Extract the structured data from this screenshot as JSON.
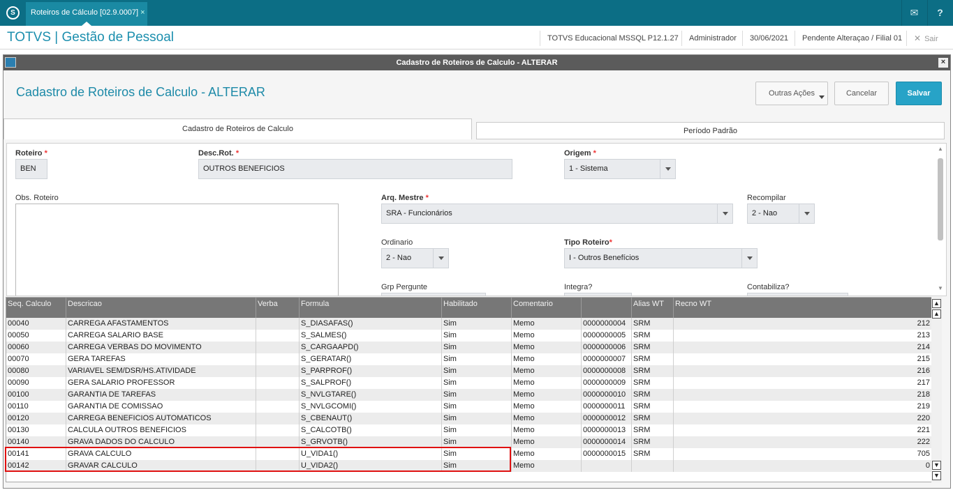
{
  "topbar": {
    "tab_title": "Roteiros de Cálculo [02.9.0007]",
    "tab_close": "×",
    "logo": "S",
    "mail_icon": "✉",
    "help_icon": "?"
  },
  "header": {
    "brand": "TOTVS | Gestão de Pessoal",
    "env": "TOTVS Educacional MSSQL P12.1.27",
    "user": "Administrador",
    "date": "30/06/2021",
    "status": "Pendente Alteraçao / Filial 01",
    "logout": "Sair",
    "logout_icon": "✕"
  },
  "window": {
    "title": "Cadastro de Roteiros de Calculo - ALTERAR",
    "close": "×"
  },
  "page": {
    "title": "Cadastro de Roteiros de Calculo - ALTERAR"
  },
  "actions": {
    "more": "Outras Ações",
    "cancel": "Cancelar",
    "save": "Salvar"
  },
  "tabs": [
    {
      "label": "Cadastro de Roteiros de Calculo"
    },
    {
      "label": "Período Padrão"
    }
  ],
  "form": {
    "roteiro": {
      "label": "Roteiro",
      "value": "BEN"
    },
    "desc": {
      "label": "Desc.Rot.",
      "value": "OUTROS BENEFICIOS"
    },
    "origem": {
      "label": "Origem",
      "value": "1 - Sistema"
    },
    "obs": {
      "label": "Obs. Roteiro",
      "value": ""
    },
    "arq_mestre": {
      "label": "Arq. Mestre",
      "value": "SRA - Funcionários"
    },
    "recompilar": {
      "label": "Recompilar",
      "value": "2 - Nao"
    },
    "ordinario": {
      "label": "Ordinario",
      "value": "2 - Nao"
    },
    "tipo_roteiro": {
      "label": "Tipo Roteiro",
      "value": "I - Outros Benefícios"
    },
    "grp_pergunte": {
      "label": "Grp Pergunte"
    },
    "integra": {
      "label": "Integra?"
    },
    "contabiliza": {
      "label": "Contabiliza?"
    },
    "required_mark": "*"
  },
  "grid": {
    "headers": [
      "Seq. Calculo",
      "Descricao",
      "Verba",
      "Formula",
      "Habilitado",
      "Comentario",
      "",
      "Alias WT",
      "Recno WT"
    ],
    "rows": [
      [
        "00040",
        "CARREGA AFASTAMENTOS",
        "",
        "S_DIASAFAS()",
        "Sim",
        "Memo",
        "0000000004",
        "SRM",
        "212"
      ],
      [
        "00050",
        "CARREGA SALARIO BASE",
        "",
        "S_SALMES()",
        "Sim",
        "Memo",
        "0000000005",
        "SRM",
        "213"
      ],
      [
        "00060",
        "CARREGA VERBAS DO MOVIMENTO",
        "",
        "S_CARGAAPD()",
        "Sim",
        "Memo",
        "0000000006",
        "SRM",
        "214"
      ],
      [
        "00070",
        "GERA TAREFAS",
        "",
        "S_GERATAR()",
        "Sim",
        "Memo",
        "0000000007",
        "SRM",
        "215"
      ],
      [
        "00080",
        "VARIAVEL SEM/DSR/HS.ATIVIDADE",
        "",
        "S_PARPROF()",
        "Sim",
        "Memo",
        "0000000008",
        "SRM",
        "216"
      ],
      [
        "00090",
        "GERA SALARIO PROFESSOR",
        "",
        "S_SALPROF()",
        "Sim",
        "Memo",
        "0000000009",
        "SRM",
        "217"
      ],
      [
        "00100",
        "GARANTIA DE TAREFAS",
        "",
        "S_NVLGTARE()",
        "Sim",
        "Memo",
        "0000000010",
        "SRM",
        "218"
      ],
      [
        "00110",
        "GARANTIA DE COMISSAO",
        "",
        "S_NVLGCOMI()",
        "Sim",
        "Memo",
        "0000000011",
        "SRM",
        "219"
      ],
      [
        "00120",
        "CARREGA BENEFICIOS AUTOMATICOS",
        "",
        "S_CBENAUT()",
        "Sim",
        "Memo",
        "0000000012",
        "SRM",
        "220"
      ],
      [
        "00130",
        "CALCULA OUTROS BENEFICIOS",
        "",
        "S_CALCOTB()",
        "Sim",
        "Memo",
        "0000000013",
        "SRM",
        "221"
      ],
      [
        "00140",
        "GRAVA DADOS DO CALCULO",
        "",
        "S_GRVOTB()",
        "Sim",
        "Memo",
        "0000000014",
        "SRM",
        "222"
      ],
      [
        "00141",
        "GRAVA CALCULO",
        "",
        "U_VIDA1()",
        "Sim",
        "Memo",
        "0000000015",
        "SRM",
        "705"
      ],
      [
        "00142",
        "GRAVAR CALCULO",
        "",
        "U_VIDA2()",
        "Sim",
        "Memo",
        "",
        "",
        "0"
      ]
    ]
  },
  "scroll_icons": {
    "top": "▲",
    "up": "▲",
    "down": "▼",
    "bottom": "▼"
  }
}
